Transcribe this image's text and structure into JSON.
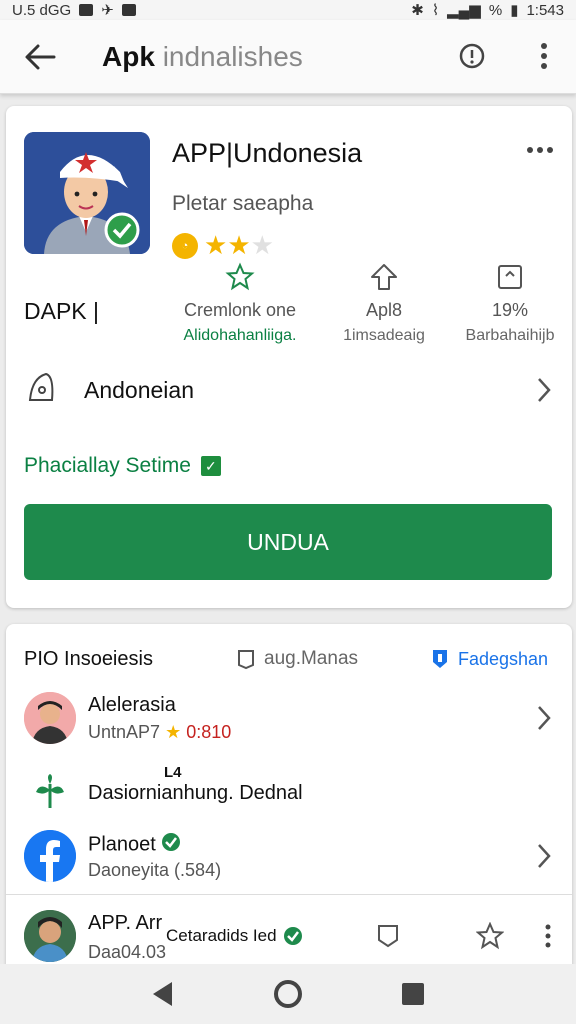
{
  "status_bar": {
    "left_text": "U.5 dGG",
    "right_text": "1:543",
    "battery_text": "%"
  },
  "app_bar": {
    "title_bold": "Apk",
    "title_light": "indnalishes"
  },
  "app": {
    "name": "APP|Undonesia",
    "developer": "Pletar saeapha",
    "rating_stars": 2,
    "rating_max": 3,
    "apk_label": "DAPK  |",
    "stats": [
      {
        "line1": "Cremlonk one",
        "line2": "Alidohahanliiga.",
        "icon": "star-outline-icon"
      },
      {
        "line1": "Apl8",
        "line2": "1imsadeaig",
        "icon": "arrow-up-outline-icon"
      },
      {
        "line1": "19%",
        "line2": "Barbahaihijb",
        "icon": "framed-square-icon"
      }
    ],
    "language_row": "Andoneian",
    "feature_text": "Phaciallay Setime",
    "install_label": "UNDUA"
  },
  "section": {
    "title": "PIO Insoeiesis",
    "mid_label": "aug.Manas",
    "right_label": "Fadegshan"
  },
  "items": [
    {
      "title": "Alelerasia",
      "sub_prefix": "UntnAP7",
      "sub_rating": "0:810"
    },
    {
      "heading_small": "L4",
      "title": "Dasiornianhung. Dednal"
    },
    {
      "title": "Planoet",
      "sub": "Daoneyita (.584)"
    },
    {
      "title": "APP. Arr",
      "sub": "Daa04.03",
      "tag": "Cetaradids Ied"
    }
  ],
  "colors": {
    "accent_green": "#1e8a4c",
    "link_blue": "#1a73e8",
    "star_gold": "#f4b400"
  }
}
